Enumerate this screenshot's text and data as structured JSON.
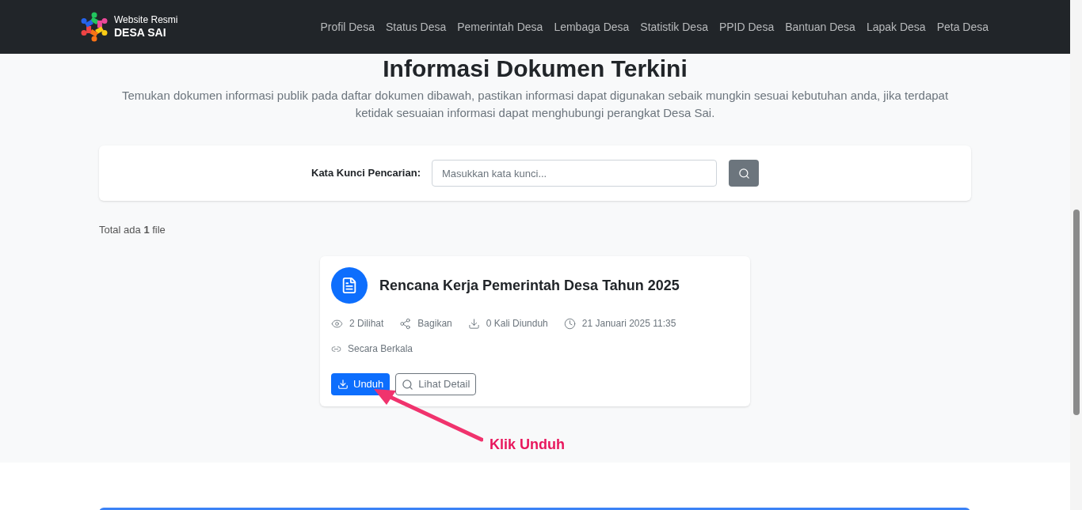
{
  "brand": {
    "subtitle": "Website Resmi",
    "name": "DESA SAI"
  },
  "nav": [
    "Profil Desa",
    "Status Desa",
    "Pemerintah Desa",
    "Lembaga Desa",
    "Statistik Desa",
    "PPID Desa",
    "Bantuan Desa",
    "Lapak Desa",
    "Peta Desa"
  ],
  "heading": "Informasi Dokumen Terkini",
  "intro": "Temukan dokumen informasi publik pada daftar dokumen dibawah, pastikan informasi dapat digunakan sebaik mungkin sesuai kebutuhan anda, jika terdapat ketidak sesuaian informasi dapat menghubungi perangkat Desa Sai.",
  "search": {
    "label": "Kata Kunci Pencarian:",
    "placeholder": "Masukkan kata kunci..."
  },
  "total": "Total ada **1** file",
  "documents": [
    {
      "title": "Rencana Kerja Pemerintah Desa Tahun 2025",
      "meta": [
        {
          "kind": "views",
          "text": "2 Dilihat"
        },
        {
          "kind": "share",
          "text": "Bagikan"
        },
        {
          "kind": "downloads",
          "text": "0 Kali Diunduh"
        },
        {
          "kind": "date",
          "text": "21 Januari 2025 11:35"
        }
      ],
      "category": "Secara Berkala",
      "download": "Unduh",
      "detail": "Lihat Detail"
    }
  ],
  "annotation": "Klik Unduh"
}
